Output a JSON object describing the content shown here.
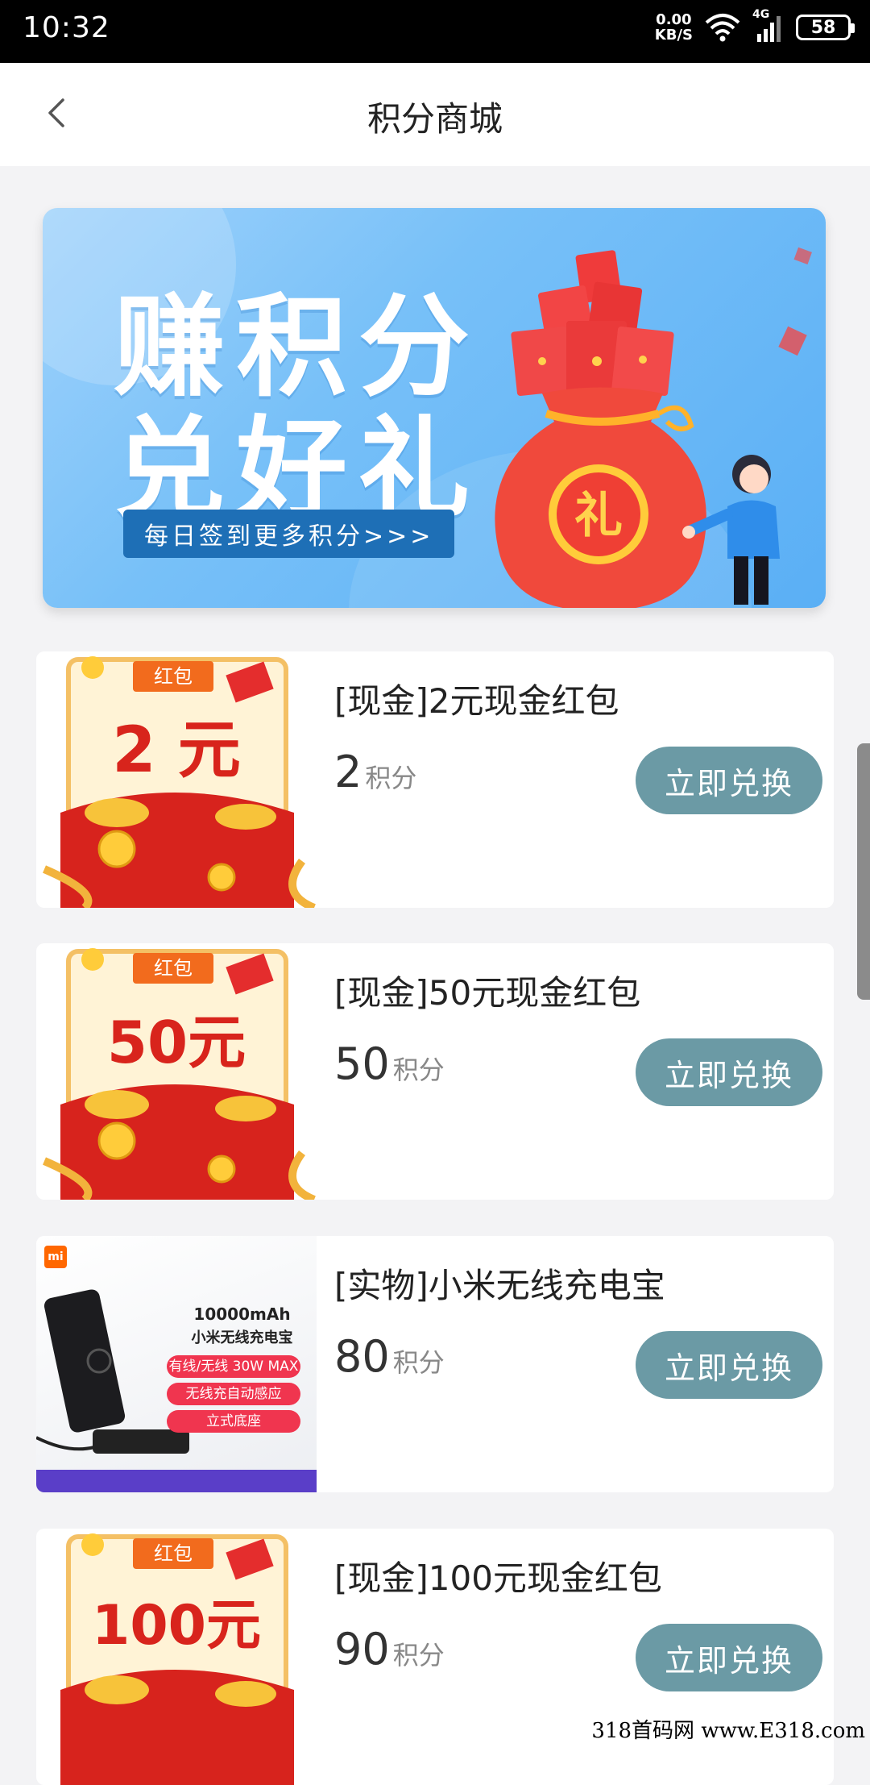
{
  "status_bar": {
    "time": "10:32",
    "speed_value": "0.00",
    "speed_unit": "KB/S",
    "network": "4G",
    "battery": "58"
  },
  "header": {
    "title": "积分商城"
  },
  "banner": {
    "line1": "赚积分",
    "line2": "兑好礼",
    "subtitle": "每日签到更多积分>>>",
    "gift_char": "礼"
  },
  "products": [
    {
      "name": "[现金]2元现金红包",
      "points": "2",
      "points_unit": "积分",
      "button": "立即兑换",
      "thumb_tag": "红包",
      "thumb_text": "2 元"
    },
    {
      "name": "[现金]50元现金红包",
      "points": "50",
      "points_unit": "积分",
      "button": "立即兑换",
      "thumb_tag": "红包",
      "thumb_text": "50元"
    },
    {
      "name": "[实物]小米无线充电宝",
      "points": "80",
      "points_unit": "积分",
      "button": "立即兑换",
      "thumb_logo": "mi",
      "thumb_capacity": "10000mAh",
      "thumb_title": "小米无线充电宝 30W",
      "thumb_features": [
        "有线/无线 30W MAX输出",
        "无线充自动感应",
        "立式底座"
      ]
    },
    {
      "name": "[现金]100元现金红包",
      "points": "90",
      "points_unit": "积分",
      "button": "立即兑换",
      "thumb_tag": "红包",
      "thumb_text": "100元"
    }
  ],
  "watermark": "318首码网 www.E318.com"
}
